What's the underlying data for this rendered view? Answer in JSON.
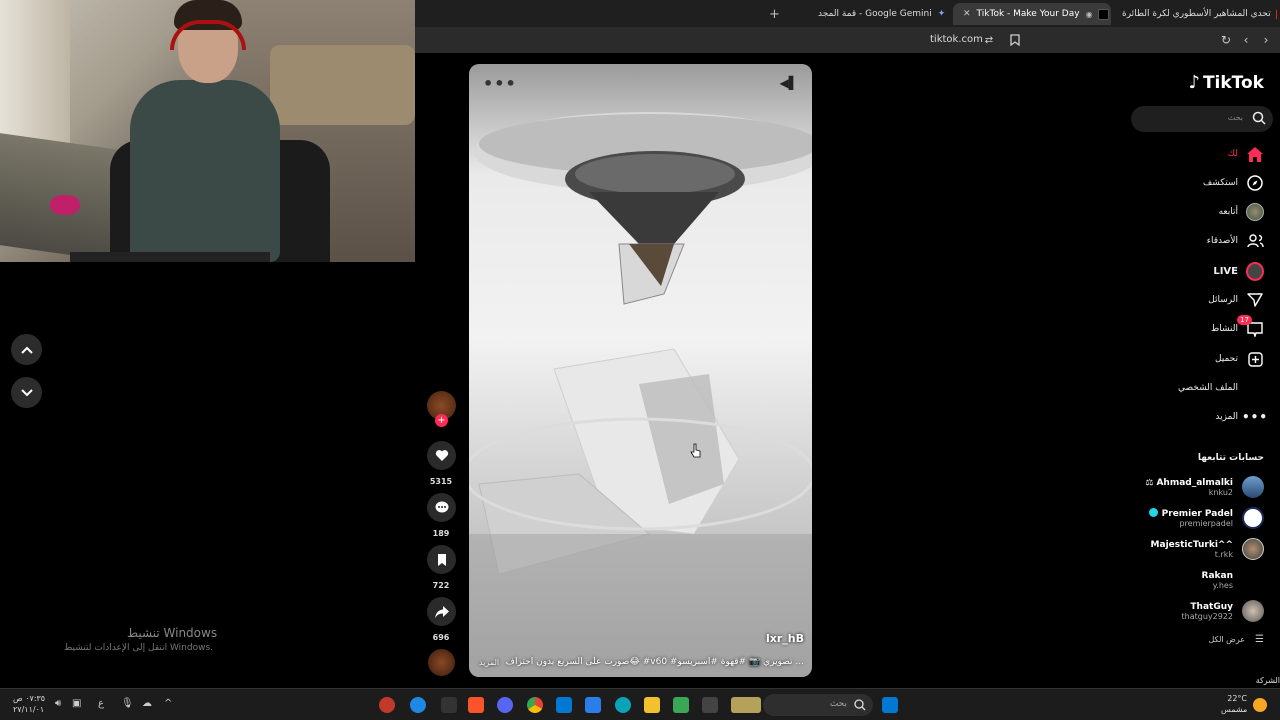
{
  "browser": {
    "tabs": [
      {
        "label": "تحدي المشاهير الأسطوري لكرة الطائرة",
        "icon": "youtube-icon"
      },
      {
        "label": "TikTok - Make Your Day",
        "icon": "tiktok-icon",
        "active": true
      },
      {
        "label": "قمة المجد - Google Gemini",
        "icon": "gemini-icon"
      }
    ],
    "new_tab": "+",
    "url": "tiktok.com"
  },
  "video": {
    "username": "lxr_hB",
    "caption": "صورت على السريع بدون احتراف😂 #v60 #تصويري 📷 #قهوة #اسبريسو ...",
    "more": "المزيد",
    "menu": "•••"
  },
  "actions": {
    "likes": "5315",
    "comments": "189",
    "saves": "722",
    "shares": "696"
  },
  "watermark": {
    "title": "تنشيط Windows",
    "subtitle": "انتقل إلى الإعدادات لتنشيط Windows."
  },
  "sidebar": {
    "logo": "TikTok",
    "search_placeholder": "بحث",
    "nav": [
      {
        "label": "لك",
        "icon": "home-icon"
      },
      {
        "label": "استكشف",
        "icon": "compass-icon"
      },
      {
        "label": "أتابعه",
        "icon": "following-avatar-icon"
      },
      {
        "label": "الأصدقاء",
        "icon": "friends-icon"
      },
      {
        "label": "LIVE",
        "icon": "live-icon"
      },
      {
        "label": "الرسائل",
        "icon": "messages-icon"
      },
      {
        "label": "النشاط",
        "icon": "activity-icon",
        "badge": "17"
      },
      {
        "label": "تحميل",
        "icon": "upload-icon"
      },
      {
        "label": "الملف الشخصي",
        "icon": "profile-icon"
      },
      {
        "label": "المزيد",
        "icon": "more-icon"
      }
    ],
    "following_title": "حسابات تتابعها",
    "accounts": [
      {
        "name": "Ahmad_almalki",
        "handle": "knku2",
        "emoji": "⚖"
      },
      {
        "name": "Premier Padel",
        "handle": "premierpadel",
        "verified": true
      },
      {
        "name": "MajesticTurki^^",
        "handle": "t.rkk"
      },
      {
        "name": "Rakan",
        "handle": "y.hes"
      },
      {
        "name": "ThatGuy",
        "handle": "thatguy2922"
      }
    ],
    "see_all": "عرض الكل",
    "company": "الشركة"
  },
  "taskbar": {
    "time": "٠٧:٣٥ ص",
    "date": "٢٧/١١/٠١",
    "lang": "ع",
    "search_placeholder": "بحث",
    "temperature": "22°C",
    "weather": "مشمس"
  },
  "colors": {
    "accent": "#fe2c55",
    "background": "#000000"
  }
}
